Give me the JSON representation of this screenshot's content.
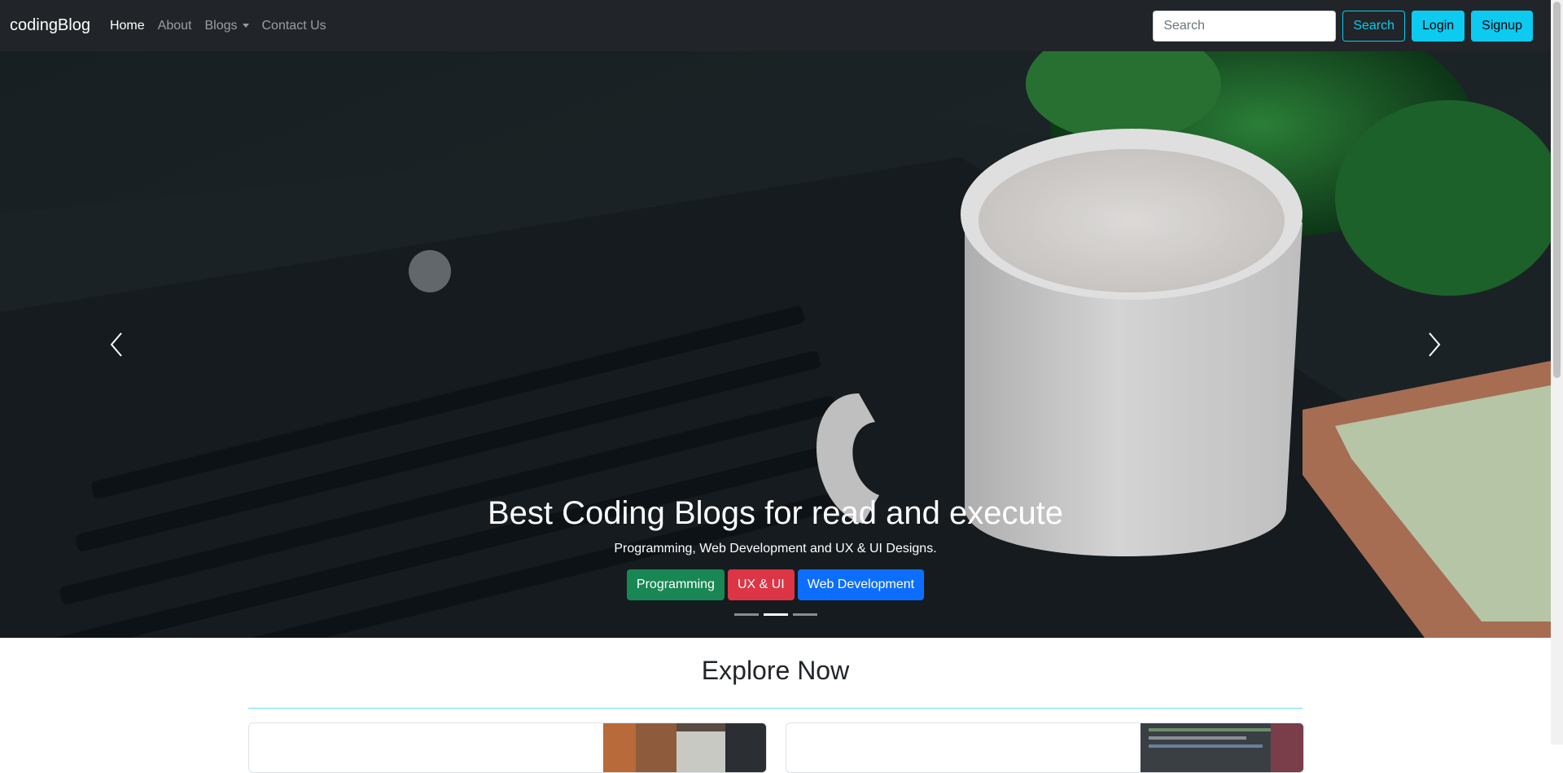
{
  "navbar": {
    "brand": "codingBlog",
    "links": [
      {
        "label": "Home",
        "active": true
      },
      {
        "label": "About",
        "active": false
      },
      {
        "label": "Blogs",
        "active": false,
        "dropdown": true
      },
      {
        "label": "Contact Us",
        "active": false
      }
    ],
    "search": {
      "placeholder": "Search",
      "value": ""
    },
    "search_button": "Search",
    "login_button": "Login",
    "signup_button": "Signup"
  },
  "carousel": {
    "title": "Best Coding Blogs for read and execute",
    "subtitle": "Programming, Web Development and UX & UI Designs.",
    "tags": [
      "Programming",
      "UX & UI",
      "Web Development"
    ],
    "active_slide": 2,
    "slide_count": 3
  },
  "explore": {
    "title": "Explore Now"
  },
  "colors": {
    "navbar_bg": "#212529",
    "info": "#0dcaf0",
    "success": "#198754",
    "danger": "#dc3545",
    "primary": "#0d6efd"
  }
}
